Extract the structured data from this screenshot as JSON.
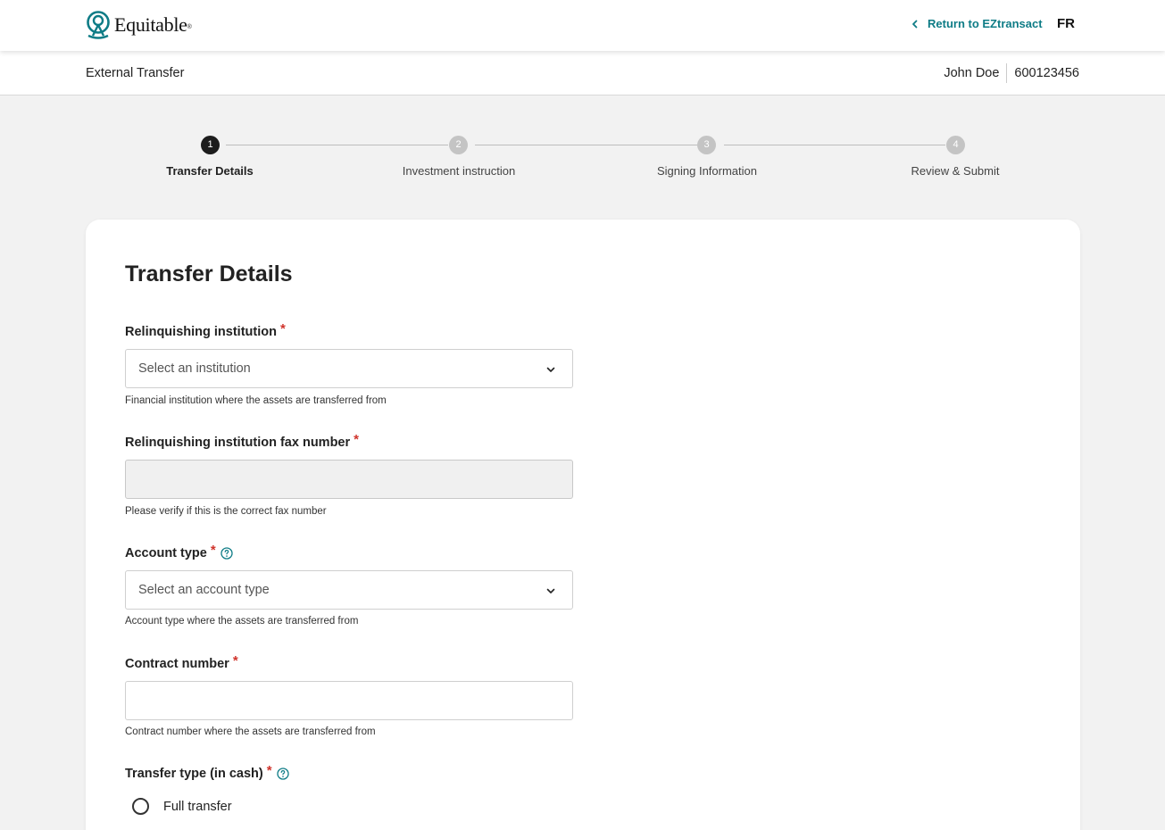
{
  "brand": {
    "name": "Equitable",
    "accent_color": "#0e7c86",
    "required_color": "#d0342c"
  },
  "topbar": {
    "return_label": "Return to EZtransact",
    "language_label": "FR"
  },
  "subheader": {
    "title": "External Transfer",
    "user_name": "John Doe",
    "account_number": "600123456"
  },
  "stepper": {
    "steps": [
      {
        "number": "1",
        "label": "Transfer Details",
        "active": true
      },
      {
        "number": "2",
        "label": "Investment instruction",
        "active": false
      },
      {
        "number": "3",
        "label": "Signing Information",
        "active": false
      },
      {
        "number": "4",
        "label": "Review & Submit",
        "active": false
      }
    ]
  },
  "form": {
    "title": "Transfer Details",
    "institution": {
      "label": "Relinquishing institution",
      "required_mark": "*",
      "placeholder": "Select an institution",
      "helper": "Financial institution where the assets are transferred from"
    },
    "fax": {
      "label": "Relinquishing institution fax number",
      "required_mark": "*",
      "value": "",
      "helper": "Please verify if this is the correct fax number"
    },
    "account_type": {
      "label": "Account type",
      "required_mark": "*",
      "placeholder": "Select an account type",
      "helper": "Account type where the assets are transferred from"
    },
    "contract_number": {
      "label": "Contract number",
      "required_mark": "*",
      "value": "",
      "helper": "Contract number where the assets are transferred from"
    },
    "transfer_type": {
      "label": "Transfer type (in cash)",
      "required_mark": "*",
      "options": [
        "Full transfer"
      ]
    }
  }
}
